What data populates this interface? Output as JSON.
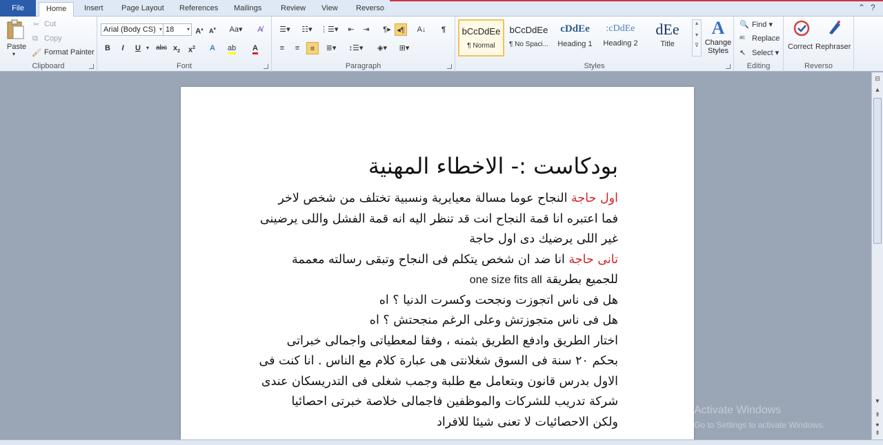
{
  "tabs": [
    "File",
    "Home",
    "Insert",
    "Page Layout",
    "References",
    "Mailings",
    "Review",
    "View",
    "Reverso"
  ],
  "active_tab": "Home",
  "clipboard": {
    "paste": "Paste",
    "cut": "Cut",
    "copy": "Copy",
    "format_painter": "Format Painter",
    "label": "Clipboard"
  },
  "font": {
    "name": "Arial (Body CS)",
    "size": "18",
    "label": "Font"
  },
  "paragraph": {
    "label": "Paragraph"
  },
  "styles": {
    "label": "Styles",
    "items": [
      {
        "sample": "bCcDdEe",
        "name": "¶ Normal"
      },
      {
        "sample": "bCcDdEe",
        "name": "¶ No Spaci..."
      },
      {
        "sample": "cDdEe",
        "name": "Heading 1"
      },
      {
        "sample": ":cDdEe",
        "name": "Heading 2"
      },
      {
        "sample": "dEe",
        "name": "Title"
      }
    ],
    "change_styles": "Change Styles"
  },
  "editing": {
    "find": "Find",
    "replace": "Replace",
    "select": "Select",
    "label": "Editing"
  },
  "reverso": {
    "correct": "Correct",
    "rephraser": "Rephraser",
    "label": "Reverso"
  },
  "document": {
    "title": "بودكاست :-  الاخطاء المهنية",
    "p1_label": "اول حاجة",
    "p1_lines": [
      " النجاح عوما مسالة معيايرية ونسبية تختلف من شخص لاخر",
      "فما اعتبره انا قمة النجاح انت قد تنظر اليه انه قمة الفشل واللى يرضينى",
      "غير اللى يرضيك دى اول حاجة"
    ],
    "p2_label": "تانى حاجة",
    "p2_line1": " انا ضد ان شخص يتكلم فى النجاح وتبقى رسالته معممة",
    "p2_line2_ar": "للجميع بطريقة",
    "p2_line2_en": "one size fits all",
    "lines": [
      "هل فى ناس اتجوزت ونجحت وكسرت الدنيا ؟ اه",
      "هل فى ناس متجوزتش وعلى الرغم منجحتش ؟ اه",
      "اختار الطريق وادفع الطريق بثمنه ، وفقا لمعطياتى واجمالى خبراتى",
      "بحكم ٢٠ سنة فى السوق شغلانتى هى عبارة كلام مع الناس . انا كنت فى",
      "الاول بدرس قانون وبتعامل مع طلبة وجمب شغلى فى التدريسكان عندى",
      "شركة تدريب للشركات والموظفين فاجمالى خلاصة خبرتى احصائيا",
      "ولكن الاحصائيات لا تعنى شيئا للافراد"
    ]
  },
  "watermark": {
    "line1": "Activate Windows",
    "line2": "Go to Settings to activate Windows."
  }
}
